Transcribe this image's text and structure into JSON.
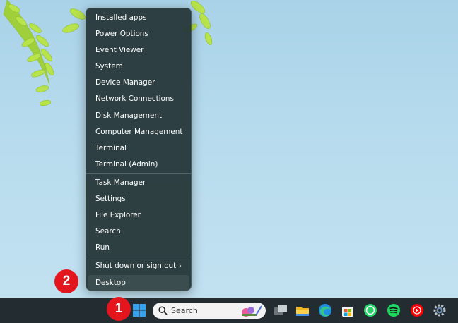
{
  "menu": {
    "items": [
      {
        "label": "Installed apps"
      },
      {
        "label": "Power Options"
      },
      {
        "label": "Event Viewer"
      },
      {
        "label": "System"
      },
      {
        "label": "Device Manager"
      },
      {
        "label": "Network Connections"
      },
      {
        "label": "Disk Management"
      },
      {
        "label": "Computer Management"
      },
      {
        "label": "Terminal"
      },
      {
        "label": "Terminal (Admin)"
      },
      {
        "label": "Task Manager"
      },
      {
        "label": "Settings"
      },
      {
        "label": "File Explorer"
      },
      {
        "label": "Search"
      },
      {
        "label": "Run"
      },
      {
        "label": "Shut down or sign out"
      },
      {
        "label": "Desktop"
      }
    ],
    "submenu_glyph": "›"
  },
  "badges": {
    "one": "1",
    "two": "2"
  },
  "taskbar": {
    "search_text": "Search",
    "icons": [
      "windows-start-icon",
      "search-icon",
      "task-view-icon",
      "file-explorer-icon",
      "edge-icon",
      "microsoft-store-icon",
      "whatsapp-icon",
      "spotify-icon",
      "youtube-music-icon",
      "settings-gear-icon"
    ]
  },
  "colors": {
    "menu_bg": "#28383a",
    "badge_red": "#e4161d",
    "taskbar_bg": "#232c31",
    "sky": "#b8dcee"
  }
}
